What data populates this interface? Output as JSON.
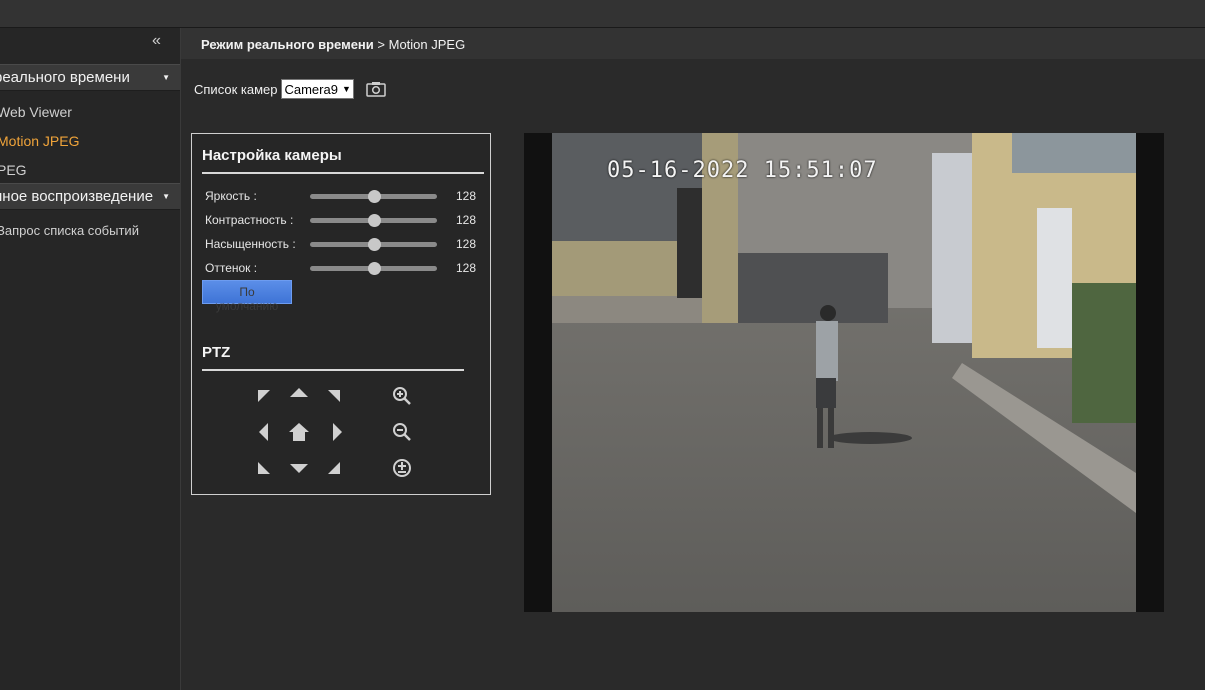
{
  "sidebar": {
    "collapse_glyph": "«",
    "sections": [
      {
        "label": "реального времени",
        "caret": "▼"
      },
      {
        "label": "нное воспроизведение",
        "caret": "▼"
      }
    ],
    "items": [
      {
        "label": "Web Viewer",
        "active": false
      },
      {
        "label": "Motion JPEG",
        "active": true
      },
      {
        "label": "PEG",
        "active": false
      },
      {
        "label": "Запрос списка событий",
        "active": false
      }
    ]
  },
  "breadcrumb": {
    "section": "Режим реального времени",
    "separator": ">",
    "current": "Motion JPEG"
  },
  "camera_list": {
    "label": "Список камер",
    "selected": "Camera9",
    "snapshot_icon": "camera-icon"
  },
  "camera_settings": {
    "title": "Настройка камеры",
    "sliders": [
      {
        "label": "Яркость :",
        "value": "128",
        "fraction": 0.5
      },
      {
        "label": "Контрастность :",
        "value": "128",
        "fraction": 0.5
      },
      {
        "label": "Насыщенность :",
        "value": "128",
        "fraction": 0.5
      },
      {
        "label": "Оттенок :",
        "value": "128",
        "fraction": 0.5
      }
    ],
    "default_button": {
      "line1": "По",
      "line2": "умолчанию"
    }
  },
  "ptz": {
    "title": "PTZ"
  },
  "video": {
    "osd_timestamp": "05-16-2022 15:51:07"
  },
  "colors": {
    "accent": "#f0a43a",
    "button_blue": "#4f84e2"
  }
}
